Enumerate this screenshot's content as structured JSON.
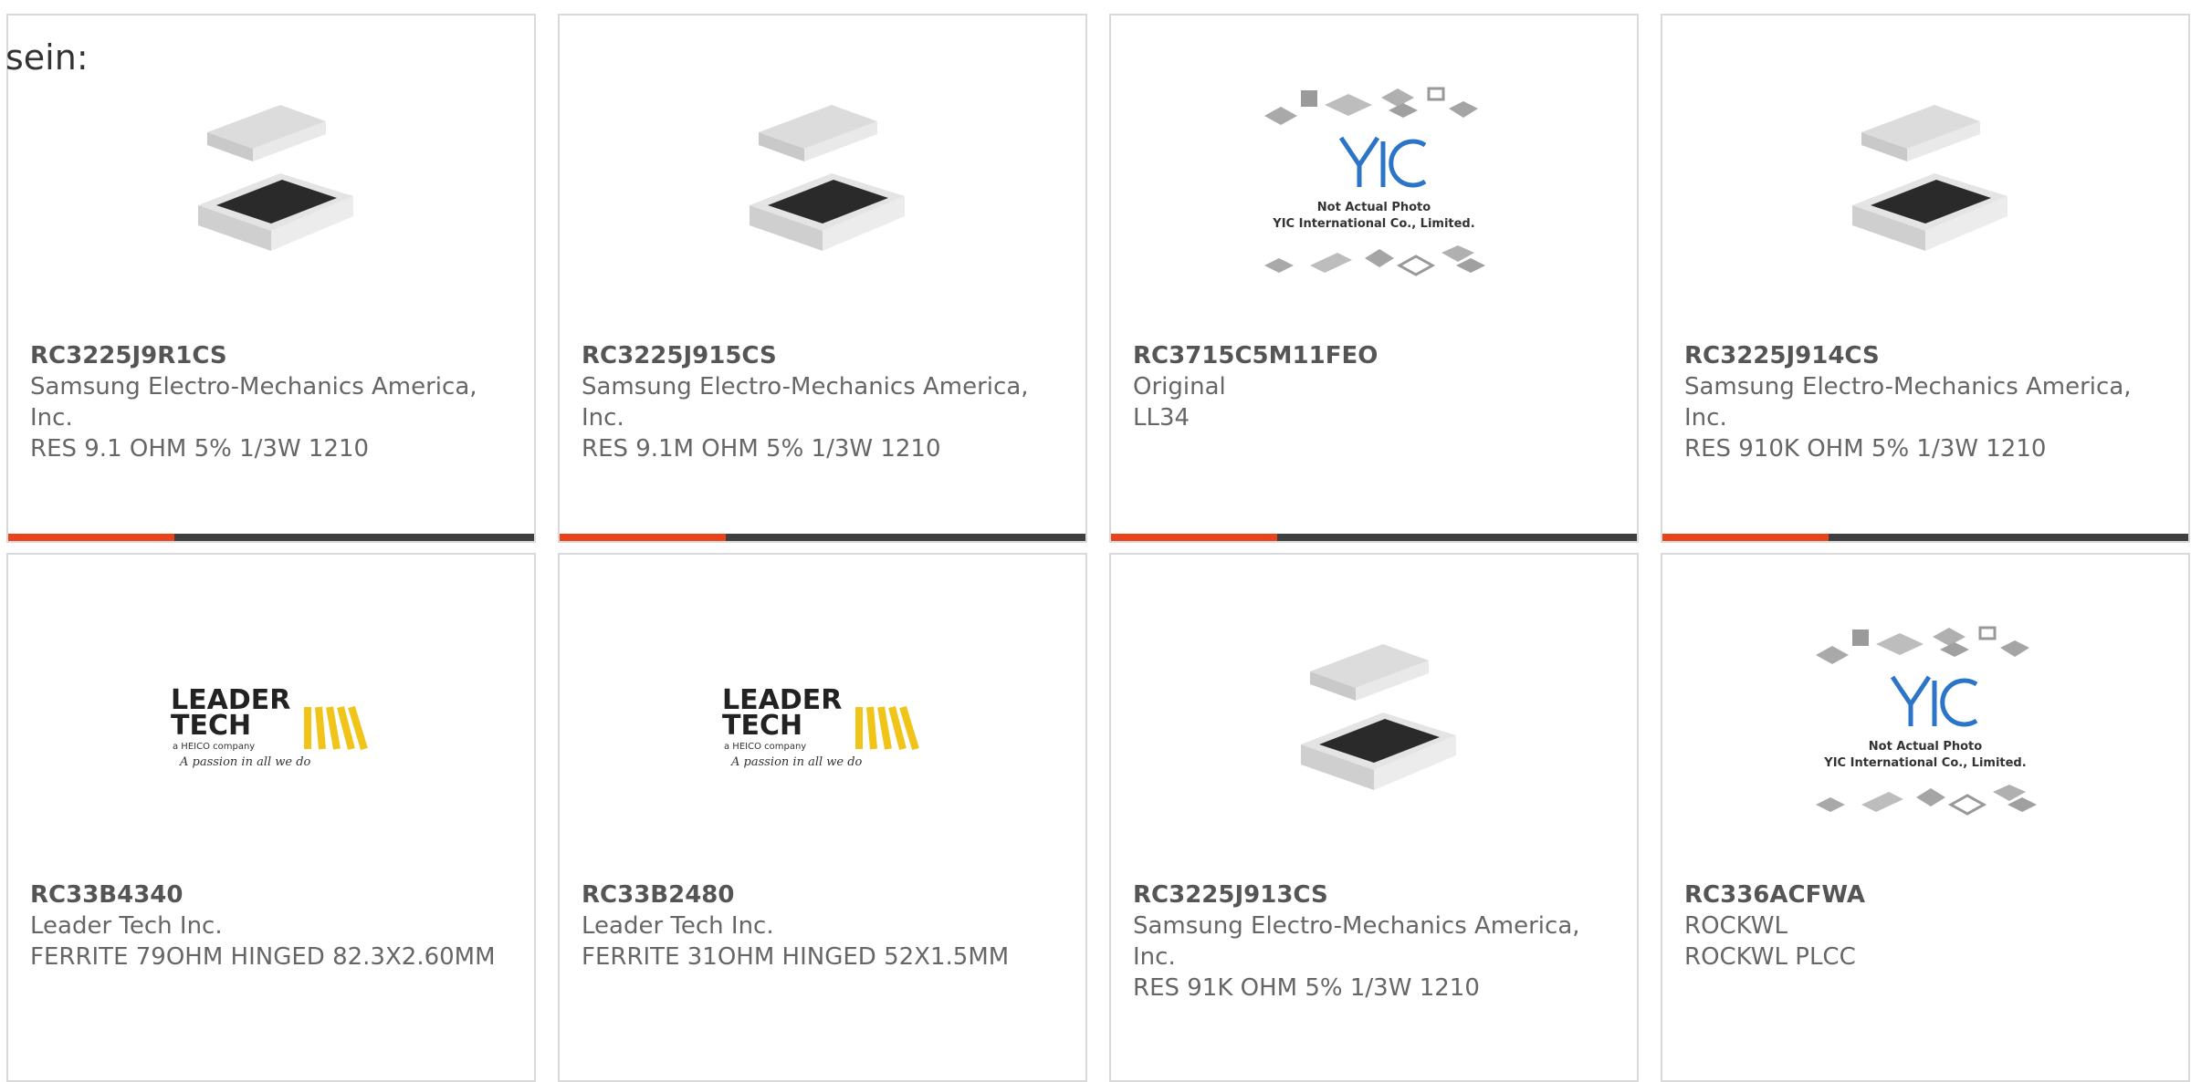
{
  "lead_text": "sein:",
  "colors": {
    "accent": "#e8431a",
    "bar": "#3f3f3f",
    "border": "#d9d9d9",
    "logo_yellow": "#f0c419"
  },
  "products": [
    {
      "part": "RC3225J9R1CS",
      "manufacturer": "Samsung Electro-Mechanics America, Inc.",
      "description": "RES 9.1 OHM 5% 1/3W 1210",
      "image": "chip-resistor-icon"
    },
    {
      "part": "RC3225J915CS",
      "manufacturer": "Samsung Electro-Mechanics America, Inc.",
      "description": "RES 9.1M OHM 5% 1/3W 1210",
      "image": "chip-resistor-icon"
    },
    {
      "part": "RC3715C5M11FEO",
      "manufacturer": "Original",
      "description": "LL34",
      "image": "yic-placeholder-icon",
      "image_caption_1": "Not Actual Photo",
      "image_caption_2": "YIC International Co., Limited."
    },
    {
      "part": "RC3225J914CS",
      "manufacturer": "Samsung Electro-Mechanics America, Inc.",
      "description": "RES 910K OHM 5% 1/3W 1210",
      "image": "chip-resistor-icon"
    },
    {
      "part": "RC33B4340",
      "manufacturer": "Leader Tech Inc.",
      "description": "FERRITE 79OHM HINGED 82.3X2.60MM",
      "image": "leader-tech-logo",
      "logo_line_1": "LEADER",
      "logo_line_2": "TECH",
      "logo_sub": "a HEICO company",
      "logo_tagline": "A passion in all we do"
    },
    {
      "part": "RC33B2480",
      "manufacturer": "Leader Tech Inc.",
      "description": "FERRITE 31OHM HINGED 52X1.5MM",
      "image": "leader-tech-logo",
      "logo_line_1": "LEADER",
      "logo_line_2": "TECH",
      "logo_sub": "a HEICO company",
      "logo_tagline": "A passion in all we do"
    },
    {
      "part": "RC3225J913CS",
      "manufacturer": "Samsung Electro-Mechanics America, Inc.",
      "description": "RES 91K OHM 5% 1/3W 1210",
      "image": "chip-resistor-icon"
    },
    {
      "part": "RC336ACFWA",
      "manufacturer": "ROCKWL",
      "description": "ROCKWL PLCC",
      "image": "yic-placeholder-icon",
      "image_caption_1": "Not Actual Photo",
      "image_caption_2": "YIC International Co., Limited."
    }
  ]
}
